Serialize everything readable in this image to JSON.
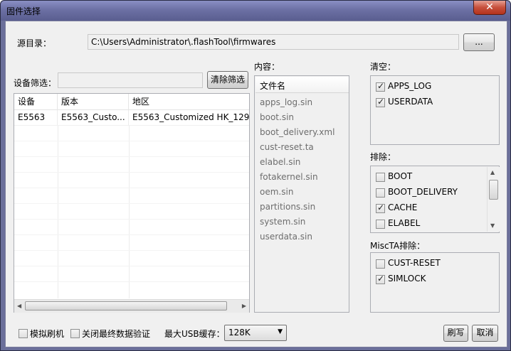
{
  "window": {
    "title": "固件选择",
    "close_glyph": "✕"
  },
  "source": {
    "label": "源目录：",
    "path": "C:\\Users\\Administrator\\.flashTool\\firmwares",
    "browse_label": "..."
  },
  "filter": {
    "label": "设备筛选：",
    "value": "",
    "clear_label": "清除筛选"
  },
  "firmware_table": {
    "columns": [
      "设备",
      "版本",
      "地区"
    ],
    "rows": [
      {
        "device": "E5563",
        "version": "E5563_Custo...",
        "region": "E5563_Customized HK_129..."
      }
    ]
  },
  "content": {
    "label": "内容：",
    "header": "文件名",
    "files": [
      "apps_log.sin",
      "boot.sin",
      "boot_delivery.xml",
      "cust-reset.ta",
      "elabel.sin",
      "fotakernel.sin",
      "oem.sin",
      "partitions.sin",
      "system.sin",
      "userdata.sin"
    ]
  },
  "wipe": {
    "label": "清空：",
    "items": [
      {
        "name": "APPS_LOG",
        "checked": true
      },
      {
        "name": "USERDATA",
        "checked": true
      }
    ]
  },
  "exclude": {
    "label": "排除：",
    "items": [
      {
        "name": "BOOT",
        "checked": false
      },
      {
        "name": "BOOT_DELIVERY",
        "checked": false
      },
      {
        "name": "CACHE",
        "checked": true
      },
      {
        "name": "ELABEL",
        "checked": false
      }
    ]
  },
  "miscta": {
    "label": "MiscTA排除：",
    "items": [
      {
        "name": "CUST-RESET",
        "checked": false
      },
      {
        "name": "SIMLOCK",
        "checked": true
      }
    ]
  },
  "bottom": {
    "simulate_label": "模拟刷机",
    "disable_verify_label": "关闭最终数据验证",
    "usb_buffer_label": "最大USB缓存：",
    "usb_buffer_value": "128K",
    "flash_label": "刷写",
    "cancel_label": "取消"
  },
  "colors": {
    "accent": "#6c70a4",
    "close": "#c7503c"
  }
}
